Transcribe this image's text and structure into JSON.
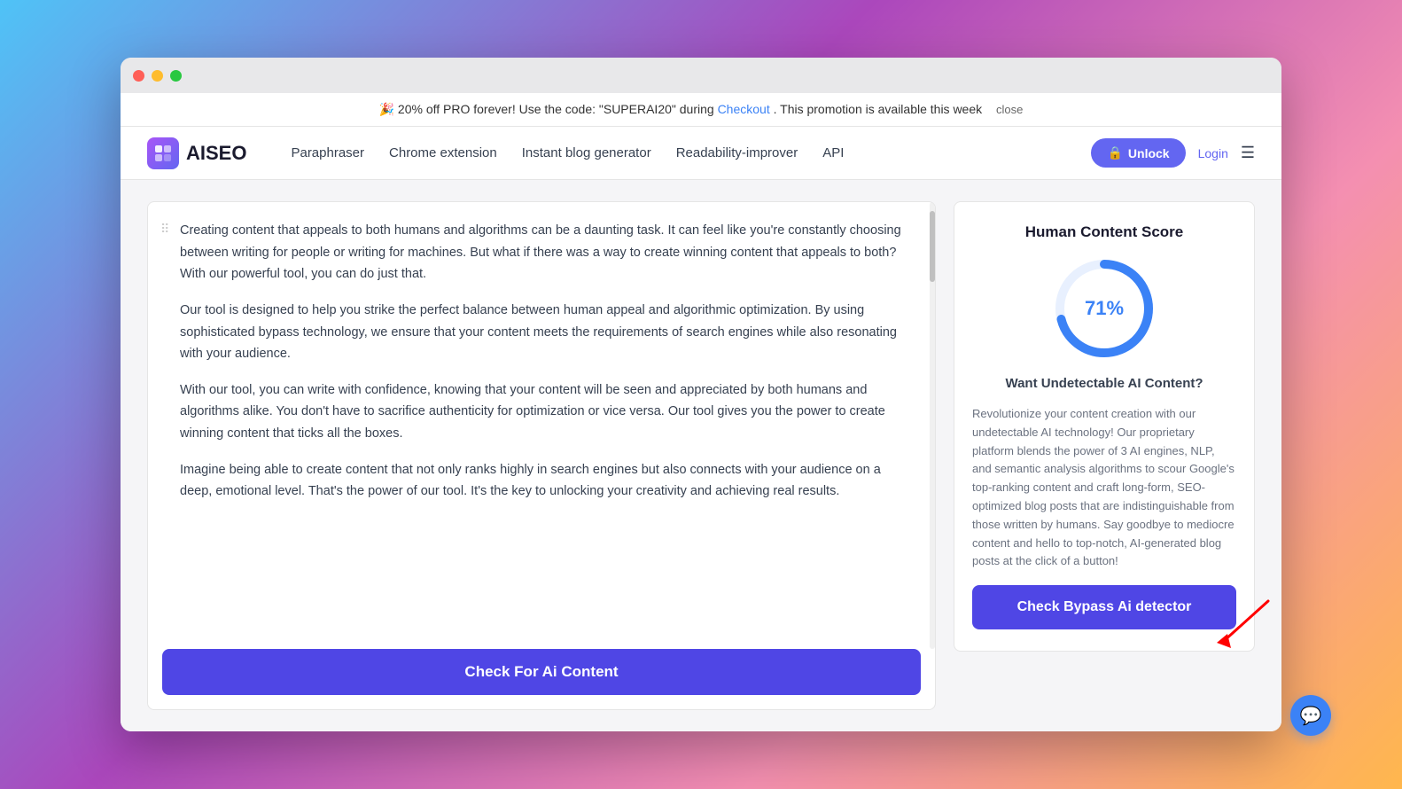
{
  "promo": {
    "text": "🎉 20% off PRO forever! Use the code: \"SUPERAI20\" during ",
    "link_text": "Checkout",
    "text2": ". This promotion is available this week",
    "close_label": "close"
  },
  "navbar": {
    "logo_text": "AISEO",
    "nav_items": [
      {
        "label": "Paraphraser"
      },
      {
        "label": "Chrome extension"
      },
      {
        "label": "Instant blog generator"
      },
      {
        "label": "Readability-improver"
      },
      {
        "label": "API"
      }
    ],
    "unlock_label": "Unlock",
    "login_label": "Login"
  },
  "left_panel": {
    "paragraph1": "Creating content that appeals to both humans and algorithms can be a daunting task. It can feel like you're constantly choosing between writing for people or writing for machines. But what if there was a way to create winning content that appeals to both? With our powerful tool, you can do just that.",
    "paragraph2": "Our tool is designed to help you strike the perfect balance between human appeal and algorithmic optimization. By using sophisticated bypass technology, we ensure that your content meets the requirements of search engines while also resonating with your audience.",
    "paragraph3": "With our tool, you can write with confidence, knowing that your content will be seen and appreciated by both humans and algorithms alike. You don't have to sacrifice authenticity for optimization or vice versa. Our tool gives you the power to create winning content that ticks all the boxes.",
    "paragraph4": "Imagine being able to create content that not only ranks highly in search engines but also connects with your audience on a deep, emotional level. That's the power of our tool. It's the key to unlocking your creativity and achieving real results.",
    "check_btn_label": "Check For Ai Content"
  },
  "right_panel": {
    "score_title": "Human Content Score",
    "score_value": "71%",
    "score_number": 71,
    "want_text": "Want Undetectable AI Content?",
    "description": "Revolutionize your content creation with our undetectable AI technology! Our proprietary platform blends the power of 3 AI engines, NLP, and semantic analysis algorithms to scour Google's top-ranking content and craft long-form, SEO-optimized blog posts that are indistinguishable from those written by humans. Say goodbye to mediocre content and hello to top-notch, AI-generated blog posts at the click of a button!",
    "bypass_btn_label": "Check Bypass Ai detector"
  },
  "colors": {
    "primary": "#4f46e5",
    "score_blue": "#3b82f6",
    "score_bg": "#e8f0fe"
  }
}
